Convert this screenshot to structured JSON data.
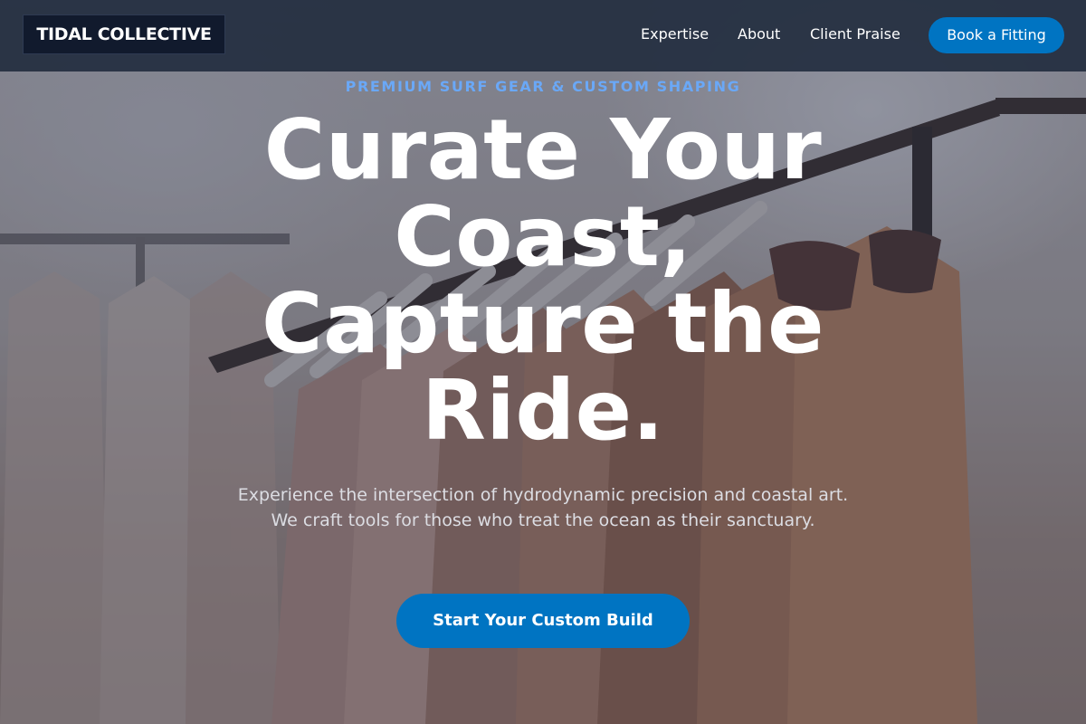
{
  "navbar": {
    "brand": "TIDAL COLLECTIVE",
    "links": [
      {
        "label": "Expertise"
      },
      {
        "label": "About"
      },
      {
        "label": "Client Praise"
      }
    ],
    "cta_label": "Book a Fitting"
  },
  "hero": {
    "eyebrow": "PREMIUM SURF GEAR & CUSTOM SHAPING",
    "headline": "Curate Your Coast, Capture the Ride.",
    "subtext": "Experience the intersection of hydrodynamic precision and coastal art. We craft tools for those who treat the ocean as their sanctuary.",
    "cta_label": "Start Your Custom Build",
    "background_image": "clothing-rack-photo"
  },
  "colors": {
    "accent": "#0074c2",
    "eyebrow": "#6aa8f7",
    "navbar_bg": "#1e293b",
    "brand_bg": "#111a2d"
  }
}
